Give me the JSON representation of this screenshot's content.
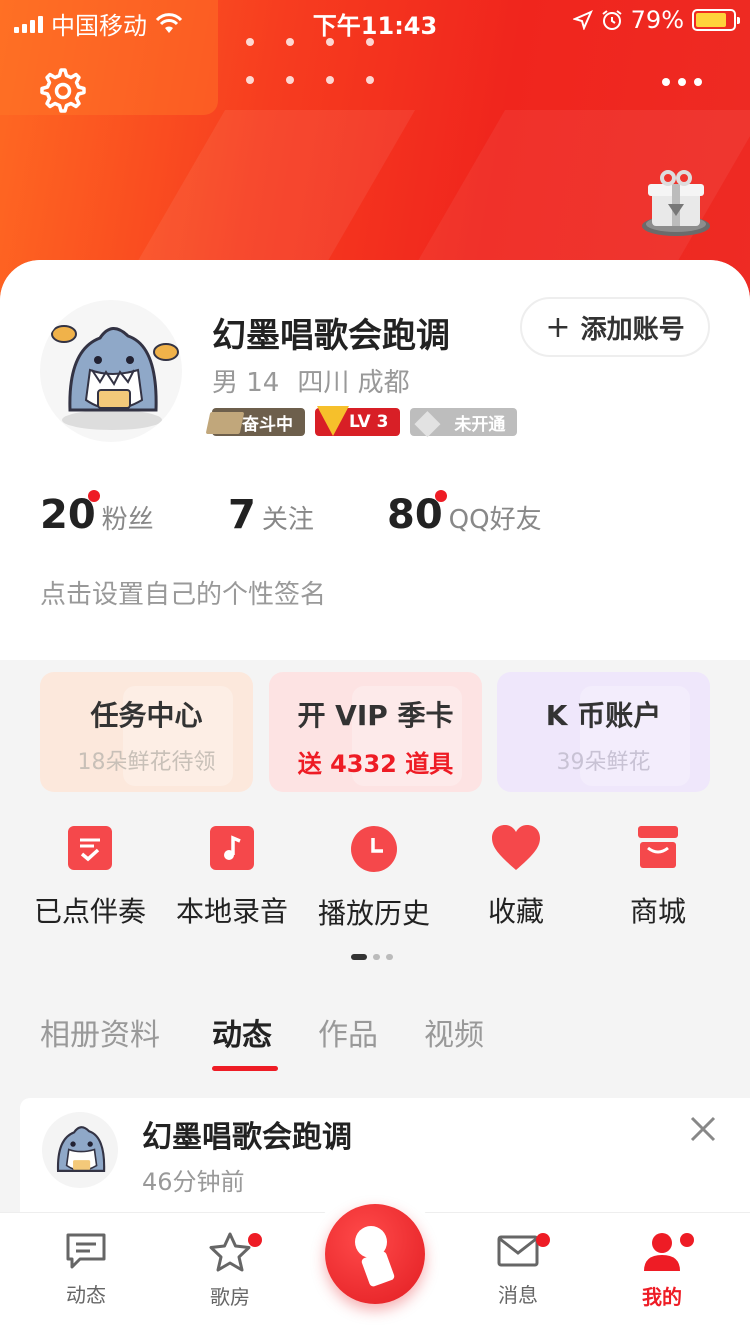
{
  "status_bar": {
    "carrier": "中国移动",
    "time": "下午11:43",
    "battery": "79%"
  },
  "profile": {
    "name": "幻墨唱歌会跑调",
    "gender_age": "男 14",
    "location": "四川 成都",
    "badges": [
      "奋斗中",
      "LV 3",
      "未开通"
    ],
    "add_account": "添加账号",
    "signature": "点击设置自己的个性签名"
  },
  "stats": [
    {
      "value": "20",
      "label": "粉丝",
      "has_dot": true
    },
    {
      "value": "7",
      "label": "关注",
      "has_dot": false
    },
    {
      "value": "80",
      "label": "QQ好友",
      "has_dot": true
    }
  ],
  "promos": [
    {
      "title": "任务中心",
      "subtitle": "18朵鲜花待领"
    },
    {
      "title": "开 VIP 季卡",
      "subtitle": "送 4332 道具"
    },
    {
      "title": "K 币账户",
      "subtitle": "39朵鲜花"
    }
  ],
  "quick_actions": [
    {
      "label": "已点伴奏",
      "icon": "checklist-icon"
    },
    {
      "label": "本地录音",
      "icon": "music-note-icon"
    },
    {
      "label": "播放历史",
      "icon": "clock-icon"
    },
    {
      "label": "收藏",
      "icon": "heart-icon"
    },
    {
      "label": "商城",
      "icon": "store-icon"
    }
  ],
  "tabs": [
    "相册资料",
    "动态",
    "作品",
    "视频"
  ],
  "active_tab": "动态",
  "feed": {
    "name": "幻墨唱歌会跑调",
    "time": "46分钟前"
  },
  "bottom_nav": [
    {
      "label": "动态",
      "icon": "chat-icon",
      "dot": false
    },
    {
      "label": "歌房",
      "icon": "star-icon",
      "dot": true
    },
    {
      "label": "",
      "icon": "microphone-icon",
      "dot": false
    },
    {
      "label": "消息",
      "icon": "mail-icon",
      "dot": true
    },
    {
      "label": "我的",
      "icon": "person-icon",
      "dot": true
    }
  ],
  "colors": {
    "brand_red": "#ee1c25",
    "hero_orange": "#ff6a22"
  }
}
